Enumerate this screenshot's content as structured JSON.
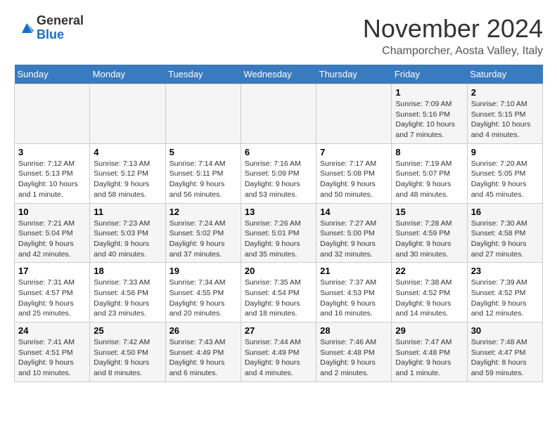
{
  "logo": {
    "general": "General",
    "blue": "Blue"
  },
  "header": {
    "month": "November 2024",
    "location": "Champorcher, Aosta Valley, Italy"
  },
  "days_of_week": [
    "Sunday",
    "Monday",
    "Tuesday",
    "Wednesday",
    "Thursday",
    "Friday",
    "Saturday"
  ],
  "weeks": [
    [
      {
        "day": "",
        "info": ""
      },
      {
        "day": "",
        "info": ""
      },
      {
        "day": "",
        "info": ""
      },
      {
        "day": "",
        "info": ""
      },
      {
        "day": "",
        "info": ""
      },
      {
        "day": "1",
        "info": "Sunrise: 7:09 AM\nSunset: 5:16 PM\nDaylight: 10 hours and 7 minutes."
      },
      {
        "day": "2",
        "info": "Sunrise: 7:10 AM\nSunset: 5:15 PM\nDaylight: 10 hours and 4 minutes."
      }
    ],
    [
      {
        "day": "3",
        "info": "Sunrise: 7:12 AM\nSunset: 5:13 PM\nDaylight: 10 hours and 1 minute."
      },
      {
        "day": "4",
        "info": "Sunrise: 7:13 AM\nSunset: 5:12 PM\nDaylight: 9 hours and 58 minutes."
      },
      {
        "day": "5",
        "info": "Sunrise: 7:14 AM\nSunset: 5:11 PM\nDaylight: 9 hours and 56 minutes."
      },
      {
        "day": "6",
        "info": "Sunrise: 7:16 AM\nSunset: 5:09 PM\nDaylight: 9 hours and 53 minutes."
      },
      {
        "day": "7",
        "info": "Sunrise: 7:17 AM\nSunset: 5:08 PM\nDaylight: 9 hours and 50 minutes."
      },
      {
        "day": "8",
        "info": "Sunrise: 7:19 AM\nSunset: 5:07 PM\nDaylight: 9 hours and 48 minutes."
      },
      {
        "day": "9",
        "info": "Sunrise: 7:20 AM\nSunset: 5:05 PM\nDaylight: 9 hours and 45 minutes."
      }
    ],
    [
      {
        "day": "10",
        "info": "Sunrise: 7:21 AM\nSunset: 5:04 PM\nDaylight: 9 hours and 42 minutes."
      },
      {
        "day": "11",
        "info": "Sunrise: 7:23 AM\nSunset: 5:03 PM\nDaylight: 9 hours and 40 minutes."
      },
      {
        "day": "12",
        "info": "Sunrise: 7:24 AM\nSunset: 5:02 PM\nDaylight: 9 hours and 37 minutes."
      },
      {
        "day": "13",
        "info": "Sunrise: 7:26 AM\nSunset: 5:01 PM\nDaylight: 9 hours and 35 minutes."
      },
      {
        "day": "14",
        "info": "Sunrise: 7:27 AM\nSunset: 5:00 PM\nDaylight: 9 hours and 32 minutes."
      },
      {
        "day": "15",
        "info": "Sunrise: 7:28 AM\nSunset: 4:59 PM\nDaylight: 9 hours and 30 minutes."
      },
      {
        "day": "16",
        "info": "Sunrise: 7:30 AM\nSunset: 4:58 PM\nDaylight: 9 hours and 27 minutes."
      }
    ],
    [
      {
        "day": "17",
        "info": "Sunrise: 7:31 AM\nSunset: 4:57 PM\nDaylight: 9 hours and 25 minutes."
      },
      {
        "day": "18",
        "info": "Sunrise: 7:33 AM\nSunset: 4:56 PM\nDaylight: 9 hours and 23 minutes."
      },
      {
        "day": "19",
        "info": "Sunrise: 7:34 AM\nSunset: 4:55 PM\nDaylight: 9 hours and 20 minutes."
      },
      {
        "day": "20",
        "info": "Sunrise: 7:35 AM\nSunset: 4:54 PM\nDaylight: 9 hours and 18 minutes."
      },
      {
        "day": "21",
        "info": "Sunrise: 7:37 AM\nSunset: 4:53 PM\nDaylight: 9 hours and 16 minutes."
      },
      {
        "day": "22",
        "info": "Sunrise: 7:38 AM\nSunset: 4:52 PM\nDaylight: 9 hours and 14 minutes."
      },
      {
        "day": "23",
        "info": "Sunrise: 7:39 AM\nSunset: 4:52 PM\nDaylight: 9 hours and 12 minutes."
      }
    ],
    [
      {
        "day": "24",
        "info": "Sunrise: 7:41 AM\nSunset: 4:51 PM\nDaylight: 9 hours and 10 minutes."
      },
      {
        "day": "25",
        "info": "Sunrise: 7:42 AM\nSunset: 4:50 PM\nDaylight: 9 hours and 8 minutes."
      },
      {
        "day": "26",
        "info": "Sunrise: 7:43 AM\nSunset: 4:49 PM\nDaylight: 9 hours and 6 minutes."
      },
      {
        "day": "27",
        "info": "Sunrise: 7:44 AM\nSunset: 4:49 PM\nDaylight: 9 hours and 4 minutes."
      },
      {
        "day": "28",
        "info": "Sunrise: 7:46 AM\nSunset: 4:48 PM\nDaylight: 9 hours and 2 minutes."
      },
      {
        "day": "29",
        "info": "Sunrise: 7:47 AM\nSunset: 4:48 PM\nDaylight: 9 hours and 1 minute."
      },
      {
        "day": "30",
        "info": "Sunrise: 7:48 AM\nSunset: 4:47 PM\nDaylight: 8 hours and 59 minutes."
      }
    ]
  ]
}
